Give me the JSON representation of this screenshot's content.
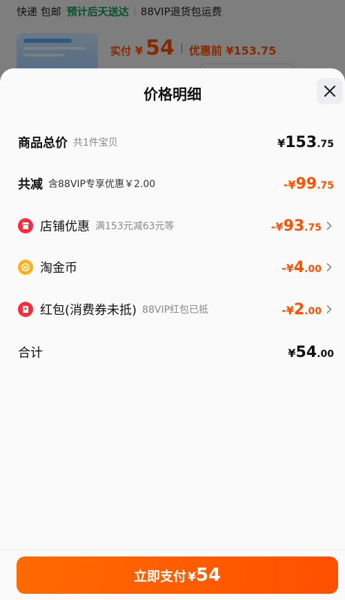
{
  "background": {
    "shipping": {
      "method": "快递 包邮",
      "delivery_tag": "预计后天送达",
      "vip_note": "88VIP退货包运费"
    },
    "pay_label": "实付",
    "pay_currency": "¥",
    "pay_amount": "54",
    "before_discount": "优惠前 ¥153.75"
  },
  "sheet": {
    "title": "价格明细",
    "close_icon": "close-icon",
    "rows": [
      {
        "name": "商品总价",
        "note": "共1件宝贝",
        "yen": "¥",
        "int": "153",
        "dec": ".75"
      },
      {
        "name": "共减",
        "note": "含88VIP专享优惠￥2.00",
        "yen": "-¥",
        "int": "99",
        "dec": ".75"
      },
      {
        "name": "店铺优惠",
        "note": "满153元减63元等",
        "yen": "-¥",
        "int": "93",
        "dec": ".75",
        "icon": "shop-icon"
      },
      {
        "name": "淘金币",
        "note": "",
        "yen": "-¥",
        "int": "4",
        "dec": ".00",
        "icon": "coin-icon"
      },
      {
        "name": "红包(消费券未抵)",
        "note": "88VIP红包已抵",
        "yen": "-¥",
        "int": "2",
        "dec": ".00",
        "icon": "red-packet-icon"
      },
      {
        "name": "合计",
        "note": "",
        "yen": "¥",
        "int": "54",
        "dec": ".00"
      }
    ]
  },
  "pay_button": {
    "label": "立即支付",
    "currency": "¥",
    "amount": "54"
  },
  "colors": {
    "accent": "#ff5000",
    "delivery_green": "#0a9b5a"
  }
}
